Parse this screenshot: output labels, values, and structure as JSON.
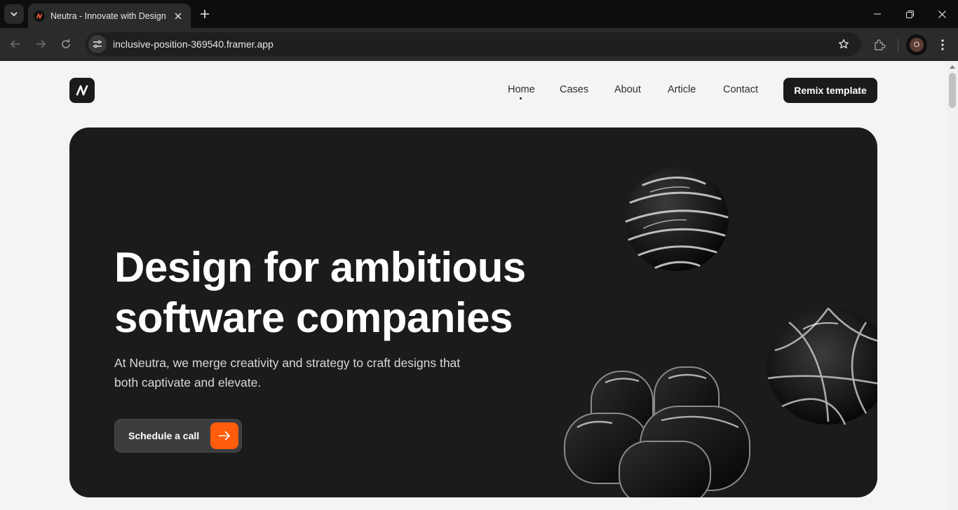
{
  "browser": {
    "tab_title": "Neutra - Innovate with Design",
    "url": "inclusive-position-369540.framer.app",
    "profile_initial": "O"
  },
  "nav": {
    "links": [
      "Home",
      "Cases",
      "About",
      "Article",
      "Contact"
    ],
    "active": "Home",
    "cta_label": "Remix template"
  },
  "hero": {
    "title_line1": "Design for ambitious",
    "title_line2": "software companies",
    "subtitle_line1": "At Neutra, we merge creativity and strategy to craft designs that",
    "subtitle_line2": "both captivate and elevate.",
    "cta_label": "Schedule a call"
  },
  "colors": {
    "accent": "#ff5c0b",
    "dark": "#1b1b1d",
    "page_bg": "#f4f4f6"
  },
  "icons": [
    "tab-search-icon",
    "neutra-logo-icon",
    "close-icon",
    "plus-icon",
    "minimize-icon",
    "restore-icon",
    "back-icon",
    "forward-icon",
    "reload-icon",
    "site-info-icon",
    "star-icon",
    "extensions-icon",
    "menu-icon",
    "arrow-right-icon"
  ]
}
